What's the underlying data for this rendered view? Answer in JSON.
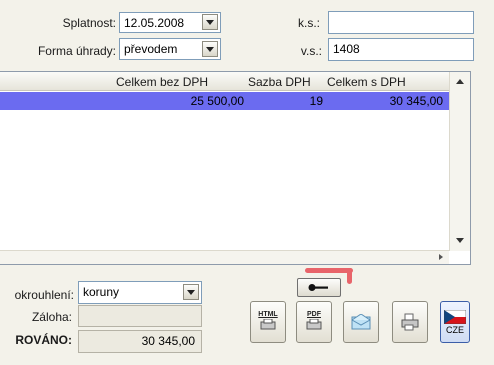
{
  "header": {
    "splatnost_label": "Splatnost:",
    "splatnost_value": "12.05.2008",
    "forma_label": "Forma úhrady:",
    "forma_value": "převodem",
    "ks_label": "k.s.:",
    "ks_value": "",
    "vs_label": "v.s.:",
    "vs_value": "1408"
  },
  "grid": {
    "columns": [
      "Celkem bez DPH",
      "Sazba DPH",
      "Celkem s DPH"
    ],
    "rows": [
      {
        "celkem_bez_dph": "25 500,00",
        "sazba_dph": "19",
        "celkem_s_dph": "30 345,00"
      }
    ]
  },
  "footer": {
    "zaokrouhleni_label": "okrouhlení:",
    "zaokrouhleni_value": "koruny",
    "zaloha_label": "Záloha:",
    "zaloha_value": "",
    "total_label": "ROVÁNO:",
    "total_value": "30 345,00"
  },
  "toolbar": {
    "html_label": "HTML",
    "pdf_label": "PDF",
    "lang_label": "CZE"
  },
  "colors": {
    "selection": "#6b6bf0",
    "highlight_mark": "#e8646a"
  }
}
